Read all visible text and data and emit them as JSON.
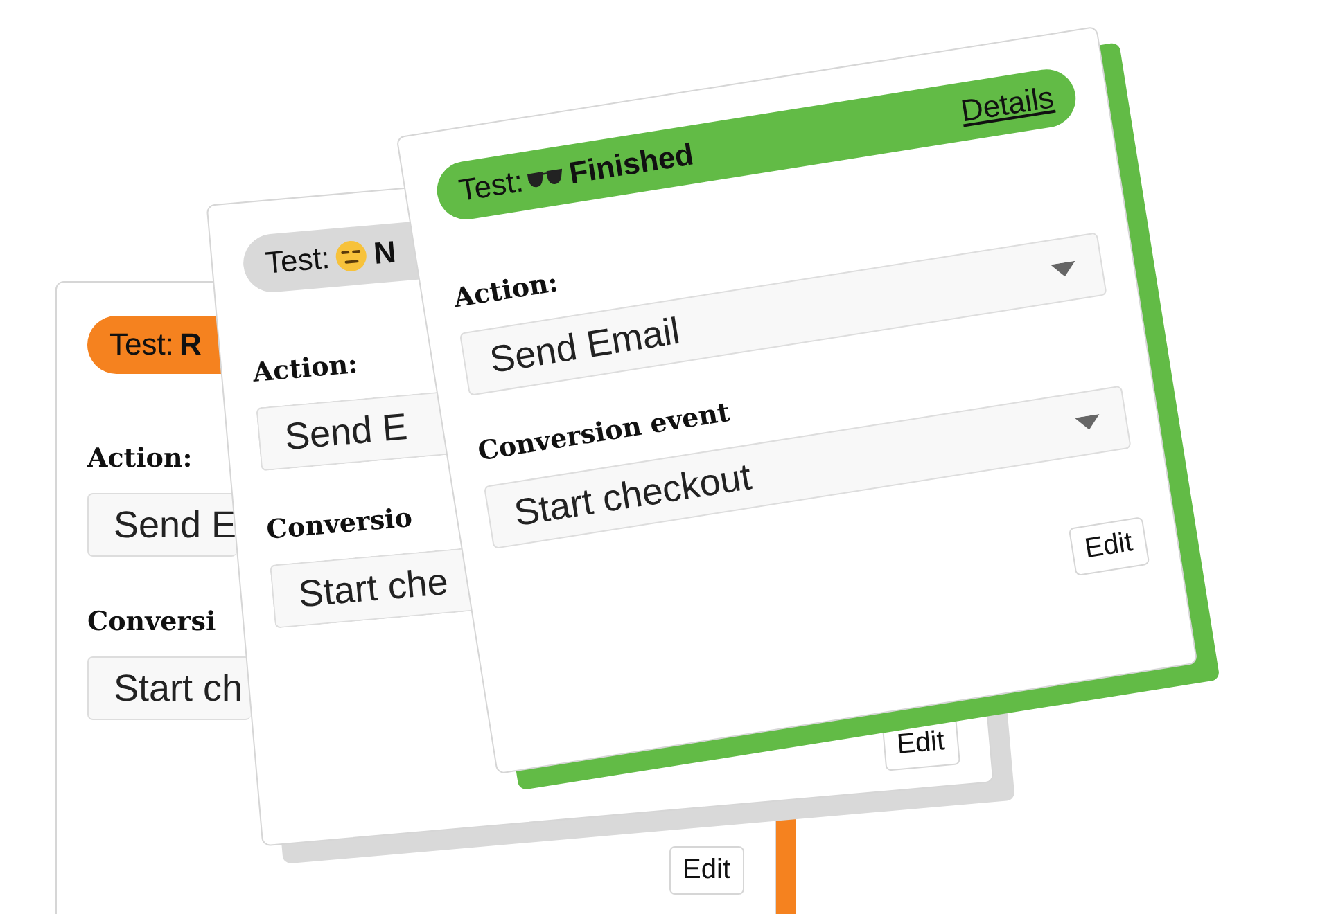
{
  "cards": [
    {
      "status": {
        "kind": "running",
        "label": "Test:",
        "value": "R",
        "color": "#f5821f"
      },
      "fields": [
        {
          "label": "Action:",
          "value": "Send E"
        },
        {
          "label": "Conversi",
          "value": "Start ch"
        }
      ],
      "button": "Edit"
    },
    {
      "status": {
        "kind": "neutral",
        "label": "Test:",
        "value": "N",
        "color": "#d9d9d9"
      },
      "fields": [
        {
          "label": "Action:",
          "value": "Send E"
        },
        {
          "label": "Conversio",
          "value": "Start che"
        }
      ],
      "button": "Edit"
    },
    {
      "status": {
        "kind": "finished",
        "label": "Test:",
        "value": "Finished",
        "color": "#62bb46",
        "link": "Details"
      },
      "fields": [
        {
          "label": "Action:",
          "value": "Send Email",
          "caret": true
        },
        {
          "label": "Conversion event",
          "value": "Start checkout",
          "caret": true
        }
      ],
      "button": "Edit"
    }
  ]
}
